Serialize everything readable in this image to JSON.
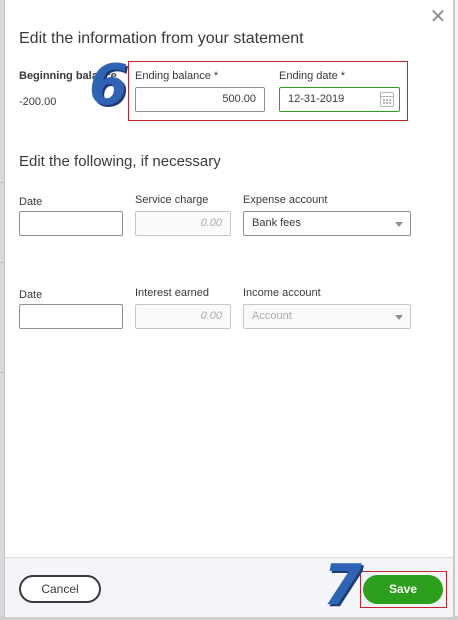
{
  "dialog": {
    "close_glyph": "✕",
    "statement_heading": "Edit the information from your statement",
    "beginning_balance_label": "Beginning balance",
    "beginning_balance_value": "-200.00",
    "ending_balance_label": "Ending balance *",
    "ending_balance_value": "500.00",
    "ending_date_label": "Ending date *",
    "ending_date_value": "12-31-2019",
    "adjust_heading": "Edit the following, if necessary",
    "service_row": {
      "date_label": "Date",
      "date_value": "",
      "charge_label": "Service charge",
      "charge_placeholder": "0.00",
      "account_label": "Expense account",
      "account_value": "Bank fees"
    },
    "interest_row": {
      "date_label": "Date",
      "date_value": "",
      "interest_label": "Interest earned",
      "interest_placeholder": "0.00",
      "account_label": "Income account",
      "account_placeholder": "Account"
    },
    "footer": {
      "cancel_label": "Cancel",
      "save_label": "Save"
    }
  },
  "annotations": {
    "step_6": "6",
    "step_7": "7"
  },
  "colors": {
    "accent_green": "#2ca01c",
    "highlight_red": "#c4242e",
    "annotation_blue": "#2f63b6"
  }
}
